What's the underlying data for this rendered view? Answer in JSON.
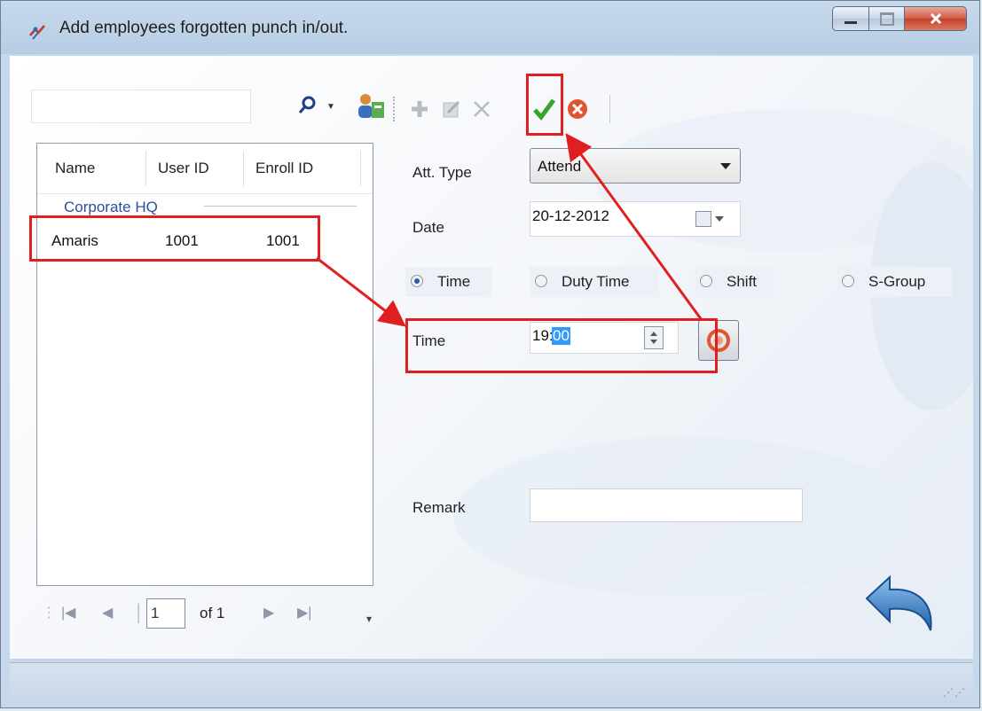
{
  "window": {
    "title": "Add employees forgotten punch in/out."
  },
  "employee_list": {
    "columns": [
      "Name",
      "User ID",
      "Enroll ID"
    ],
    "group": "Corporate HQ",
    "rows": [
      {
        "name": "Amaris",
        "user_id": "1001",
        "enroll_id": "1001"
      }
    ]
  },
  "pager": {
    "page": "1",
    "of_label": "of 1"
  },
  "form": {
    "att_type_label": "Att. Type",
    "att_type_value": "Attend",
    "date_label": "Date",
    "date_value": "20-12-2012",
    "mode_options": [
      {
        "label": "Time",
        "checked": true
      },
      {
        "label": "Duty Time",
        "checked": false
      },
      {
        "label": "Shift",
        "checked": false
      },
      {
        "label": "S-Group",
        "checked": false
      }
    ],
    "time_label": "Time",
    "time_hours": "19:",
    "time_minutes": "00",
    "remark_label": "Remark",
    "remark_value": ""
  },
  "toolbar_icons": [
    "add-icon",
    "edit-icon",
    "delete-icon",
    "save-check-icon",
    "cancel-icon"
  ],
  "colors": {
    "highlight": "#e02020",
    "link_blue": "#2a4fa0",
    "selection_blue": "#3399ff"
  }
}
